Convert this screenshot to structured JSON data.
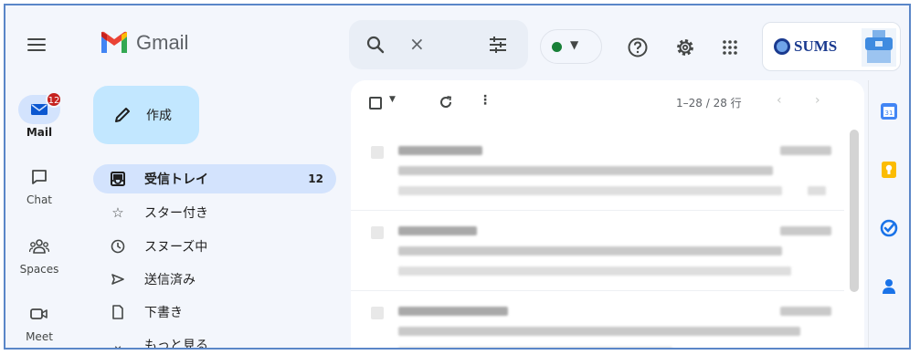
{
  "app": {
    "name": "Gmail"
  },
  "search": {
    "clear_glyph": "×"
  },
  "account": {
    "brand": "SUMS"
  },
  "rail": [
    {
      "label": "Mail",
      "badge": "12",
      "icon": "mail-icon"
    },
    {
      "label": "Chat",
      "icon": "chat-icon"
    },
    {
      "label": "Spaces",
      "icon": "spaces-icon"
    },
    {
      "label": "Meet",
      "icon": "meet-icon"
    }
  ],
  "compose": {
    "label": "作成"
  },
  "nav": [
    {
      "label": "受信トレイ",
      "count": "12",
      "icon": "inbox-icon",
      "active": true
    },
    {
      "label": "スター付き",
      "icon": "star-icon"
    },
    {
      "label": "スヌーズ中",
      "icon": "snooze-icon"
    },
    {
      "label": "送信済み",
      "icon": "send-icon"
    },
    {
      "label": "下書き",
      "icon": "draft-icon"
    },
    {
      "label": "もっと見る",
      "icon": "chevron-down-icon"
    }
  ],
  "toolbar": {
    "pager": "1–28 / 28 行"
  },
  "colors": {
    "accent": "#c2e7ff",
    "active_nav": "#d3e3fd",
    "badge": "#c5221f",
    "status": "#188038"
  }
}
